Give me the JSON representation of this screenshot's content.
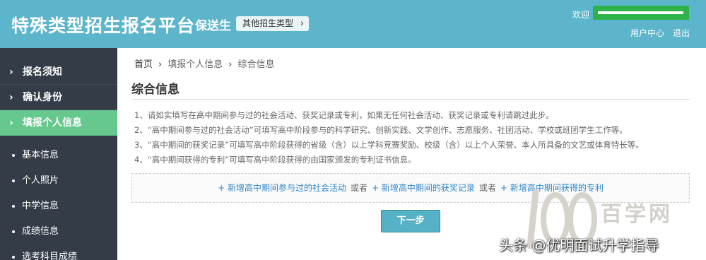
{
  "header": {
    "brand": "特殊类型招生报名平台",
    "subtitle": "保送生",
    "other_types_label": "其他招生类型",
    "welcome": "欢迎",
    "user_center": "用户中心",
    "logout": "退出"
  },
  "sidebar": {
    "items": [
      {
        "label": "报名须知"
      },
      {
        "label": "确认身份"
      },
      {
        "label": "填报个人信息"
      }
    ],
    "subitems": [
      {
        "label": "基本信息"
      },
      {
        "label": "个人照片"
      },
      {
        "label": "中学信息"
      },
      {
        "label": "成绩信息"
      },
      {
        "label": "选考科目成绩"
      }
    ]
  },
  "breadcrumb": {
    "home": "首页",
    "level2": "填报个人信息",
    "level3": "综合信息"
  },
  "main": {
    "title": "综合信息",
    "notes": [
      "1、请如实填写在高中期间参与过的社会活动、获奖记录或专利，如果无任何社会活动、获奖记录或专利请跳过此步。",
      "2、“高中期间参与过的社会活动”可填写高中阶段参与的科学研究、创新实践、文学创作、志愿服务、社团活动、学校或班团学生工作等。",
      "3、“高中期间的获奖记录”可填写高中阶段获得的省级（含）以上学科竞赛奖励、校级（含）以上个人荣誉、本人所具备的文艺或体育特长等。",
      "4、“高中期间获得的专利”可填写高中阶段获得的由国家颁发的专利证书信息。"
    ],
    "actions": {
      "add_activity": "+ 新增高中期间参与过的社会活动",
      "or1": "或者",
      "add_award": "+ 新增高中期间的获奖记录",
      "or2": "或者",
      "add_patent": "+ 新增高中期间获得的专利"
    },
    "next_label": "下一步"
  },
  "watermark": {
    "site": "百学网",
    "credit": "头条 @优明面试升学指导"
  },
  "colors": {
    "header_bg": "#5db5cc",
    "sidebar_bg": "#333c47",
    "active_nav": "#67c88e",
    "username_box": "#2db34a",
    "link": "#2e86c9",
    "button": "#56b0c6"
  }
}
